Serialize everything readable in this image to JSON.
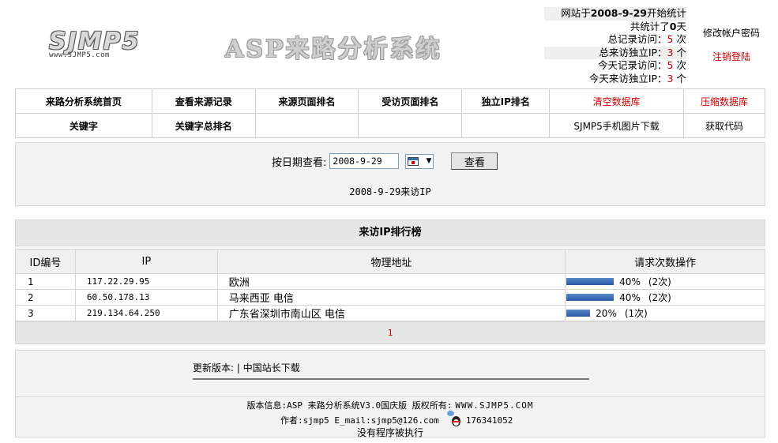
{
  "header": {
    "logo_text": "SJMP5",
    "logo_url_text": "www.SJMP5.com",
    "app_title": "ASP来路分析系统"
  },
  "stats": {
    "start_prefix": "网站于",
    "start_date": "2008-9-29",
    "start_suffix": "开始统计",
    "total_days_prefix": "共统计了",
    "total_days": "0",
    "total_days_suffix": "天",
    "total_visits_label": "总记录访问：",
    "total_visits": "5",
    "total_visits_unit": "次",
    "total_ips_label": "总来访独立IP：",
    "total_ips": "3",
    "total_ips_unit": "个",
    "today_visits_label": "今天记录访问：",
    "today_visits": "5",
    "today_visits_unit": "次",
    "today_ips_label": "今天来访独立IP：",
    "today_ips": "3",
    "today_ips_unit": "个"
  },
  "account": {
    "edit_password": "修改帐户密码",
    "logout": "注销登陆"
  },
  "nav": {
    "row1": [
      "来路分析系统首页",
      "查看来源记录",
      "来源页面排名",
      "受访页面排名",
      "独立IP排名",
      "清空数据库",
      "压缩数据库"
    ],
    "row2": [
      "关键字",
      "关键字总排名",
      "",
      "",
      "",
      "SJMP5手机图片下载",
      "获取代码"
    ]
  },
  "date_query": {
    "label": "按日期查看:",
    "value": "2008-9-29",
    "button": "查看",
    "caption": "2008-9-29来访IP"
  },
  "ranking": {
    "title": "来访IP排行榜",
    "columns": [
      "ID编号",
      "IP",
      "物理地址",
      "请求次数操作"
    ],
    "rows": [
      {
        "id": "1",
        "ip": "117.22.29.95",
        "location": "欧洲",
        "percent": 40,
        "percent_text": "40%",
        "count_text": "(2次)"
      },
      {
        "id": "2",
        "ip": "60.50.178.13",
        "location": "马来西亚 电信",
        "percent": 40,
        "percent_text": "40%",
        "count_text": "(2次)"
      },
      {
        "id": "3",
        "ip": "219.134.64.250",
        "location": "广东省深圳市南山区 电信",
        "percent": 20,
        "percent_text": "20%",
        "count_text": "(1次)"
      }
    ],
    "page": "1"
  },
  "footer": {
    "update_text": "更新版本: | 中国站长下载",
    "version_info": "版本信息:ASP 来路分析系统V3.0国庆版  版权所有:",
    "site": "WWW.SJMP5.COM",
    "author": "作者:sjmp5 E_mail:sjmp5@126.com",
    "qq": "176341052",
    "no_exec": "没有程序被执行"
  }
}
